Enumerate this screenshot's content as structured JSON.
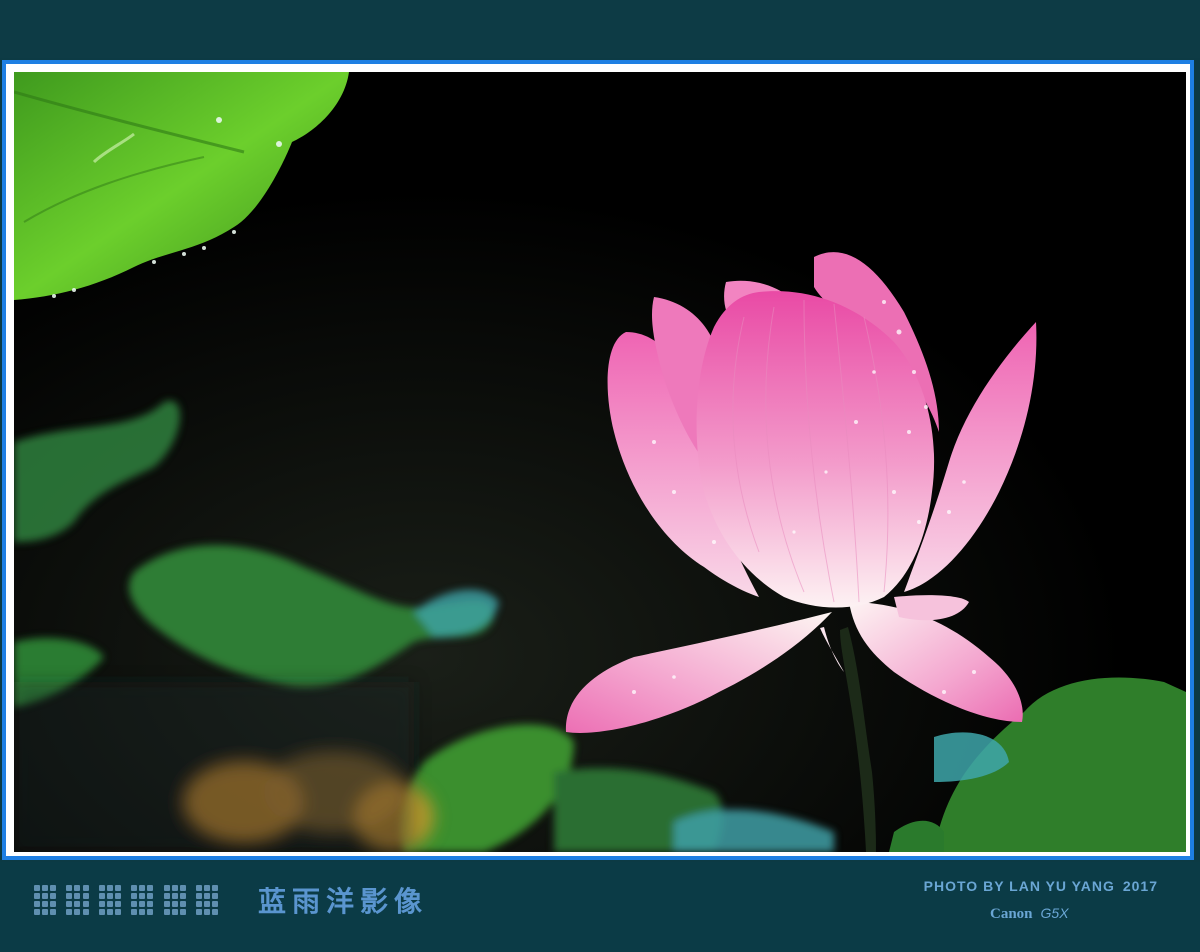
{
  "photo": {
    "subject": "pink-lotus-flower",
    "colors": {
      "background": "#000000",
      "petal_pink": "#f07fc0",
      "petal_light": "#fbe6ef",
      "leaf_green": "#5bbf2e",
      "frame_blue": "#1e7fe3",
      "band": "#0b3b46"
    }
  },
  "footer": {
    "studio_name": "蓝雨洋影像",
    "credit": "PHOTO BY LAN YU YANG",
    "year": "2017",
    "camera_brand": "Canon",
    "camera_model": "G5X"
  }
}
